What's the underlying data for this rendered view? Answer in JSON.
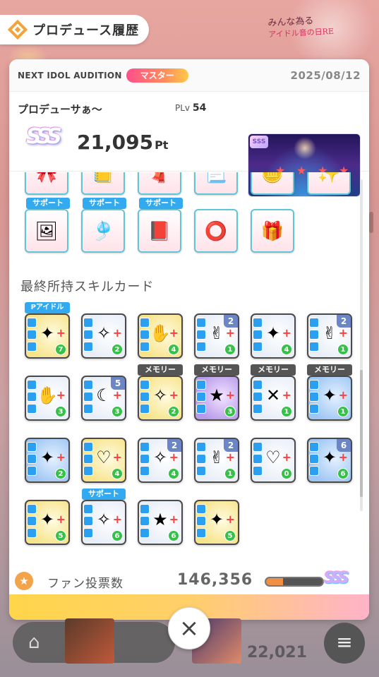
{
  "header": {
    "title": "プロデュース履歴",
    "icon": "produce-history-icon"
  },
  "background": {
    "logo_line1": "みんな為る",
    "logo_line2": "アイドル音の日RE",
    "score": "22,021"
  },
  "result": {
    "audition_name": "NEXT IDOL AUDITION",
    "difficulty": "マスター",
    "date": "2025/08/12",
    "producer_name": "プロデューサぁ～",
    "plv_label": "PLv",
    "plv_value": "54",
    "rank": "SSS",
    "score": "21,095",
    "score_unit": "Pt",
    "thumb_rank": "SSS"
  },
  "items": {
    "support_label": "サポート"
  },
  "skill_section": {
    "title": "最終所持スキルカード"
  },
  "tags": {
    "memory": "メモリー",
    "pidol": "Pアイドル",
    "support": "サポート"
  },
  "cards": [
    {
      "num": "7",
      "lvl": ""
    },
    {
      "num": "2",
      "lvl": ""
    },
    {
      "num": "4",
      "lvl": ""
    },
    {
      "num": "1",
      "lvl": "2"
    },
    {
      "num": "4",
      "lvl": ""
    },
    {
      "num": "1",
      "lvl": "2"
    },
    {
      "num": "3",
      "lvl": ""
    },
    {
      "num": "3",
      "lvl": "5"
    },
    {
      "num": "2",
      "lvl": ""
    },
    {
      "num": "3",
      "lvl": ""
    },
    {
      "num": "1",
      "lvl": ""
    },
    {
      "num": "1",
      "lvl": ""
    },
    {
      "num": "2",
      "lvl": ""
    },
    {
      "num": "4",
      "lvl": ""
    },
    {
      "num": "4",
      "lvl": "2"
    },
    {
      "num": "1",
      "lvl": "2"
    },
    {
      "num": "0",
      "lvl": ""
    },
    {
      "num": "6",
      "lvl": "6"
    },
    {
      "num": "5",
      "lvl": ""
    },
    {
      "num": "6",
      "lvl": ""
    },
    {
      "num": "6",
      "lvl": ""
    },
    {
      "num": "5",
      "lvl": ""
    }
  ],
  "fan_votes": {
    "label": "ファン投票数",
    "value": "146,356",
    "progress": 0.3,
    "rank": "SSS"
  },
  "close_button": "×",
  "colors": {
    "accent_blue": "#33a9f0",
    "master_pink": "#ff4f8c",
    "memory_gray": "#555555"
  }
}
